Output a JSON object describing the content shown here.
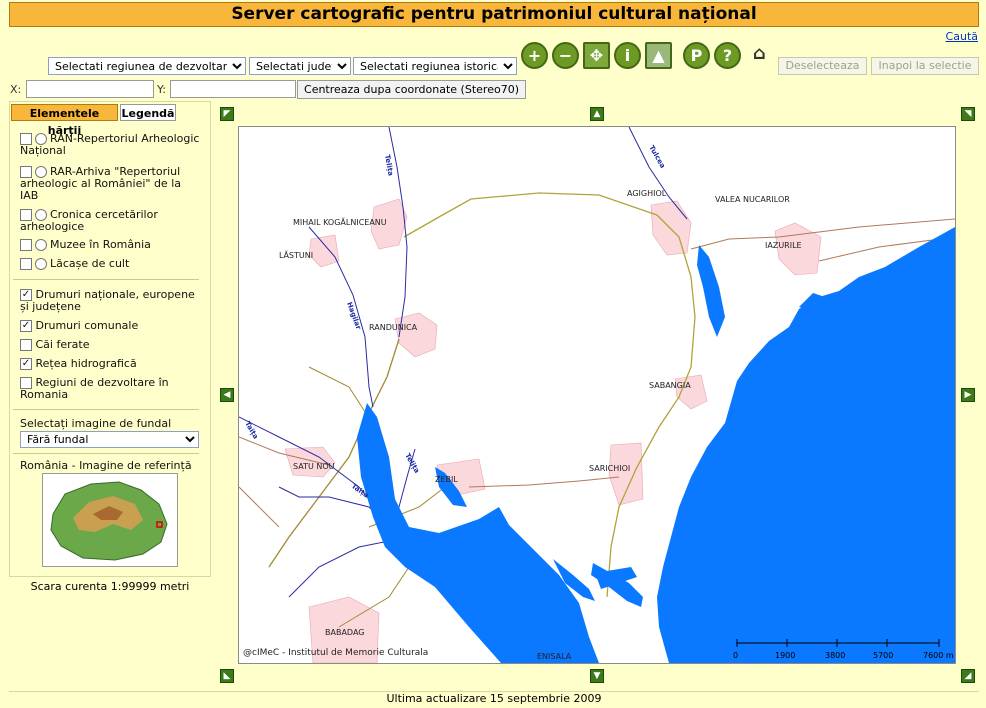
{
  "header": {
    "title": "Server cartografic pentru patrimoniul cultural național",
    "search_link": "Caută"
  },
  "toolbar": {
    "region_select": "Selectati regiunea de dezvoltare",
    "county_select": "Selectati judet",
    "historic_select": "Selectati regiunea istorica",
    "tools": [
      "zoom-in",
      "zoom-out",
      "pan",
      "info",
      "overview",
      "parking",
      "help",
      "home"
    ],
    "deselect_label": "Deselecteaza",
    "back_label": "Inapoi la selectie"
  },
  "coords": {
    "x_label": "X:",
    "y_label": "Y:",
    "center_button": "Centreaza dupa coordonate (Stereo70)"
  },
  "tabs": {
    "elements": "Elementele hărții",
    "legend": "Legendă"
  },
  "layers_group1": [
    {
      "label": "RAN-Repertoriul Arheologic Național",
      "checked": false
    },
    {
      "label": "RAR-Arhiva \"Repertoriul arheologic al României\" de la IAB",
      "checked": false
    },
    {
      "label": "Cronica cercetărilor arheologice",
      "checked": false
    },
    {
      "label": "Muzee în România",
      "checked": false
    },
    {
      "label": "Lăcașe de cult",
      "checked": false
    }
  ],
  "layers_group2": [
    {
      "label": "Drumuri naționale, europene și județene",
      "checked": true
    },
    {
      "label": "Drumuri comunale",
      "checked": true
    },
    {
      "label": "Căi ferate",
      "checked": false
    },
    {
      "label": "Rețea hidrografică",
      "checked": true
    },
    {
      "label": "Regiuni de dezvoltare în Romania",
      "checked": false
    }
  ],
  "background": {
    "label": "Selectați imagine de fundal",
    "value": "Fără fundal"
  },
  "reference": {
    "label": "România - Imagine de referință"
  },
  "scale": {
    "text": "Scara curenta 1:99999 metri"
  },
  "map": {
    "places": [
      "MIHAIL KOGĂLNICEANU",
      "LĂSTUNI",
      "RANDUNICA",
      "AGIGHIOL",
      "VALEA NUCARILOR",
      "IAZURILE",
      "SABANGIA",
      "SARICHIOI",
      "SATU NOU",
      "ZEBIL",
      "BABADAG",
      "ENISALA"
    ],
    "rivers": [
      "Telița",
      "Tulcea",
      "Hagilar",
      "Taița",
      "Telița",
      "Taița"
    ],
    "copyright": "@cIMeC - Institutul de Memorie Culturala",
    "scalebar": [
      "0",
      "1900",
      "3800",
      "5700",
      "7600 m"
    ],
    "colors": {
      "water": "#0a78ff",
      "settlement": "#fad8dc",
      "road_regional": "#b0a33a",
      "road_local": "#b07a5a",
      "river": "#2a2aa8"
    }
  },
  "footer": {
    "text": "Ultima actualizare 15 septembrie 2009"
  }
}
